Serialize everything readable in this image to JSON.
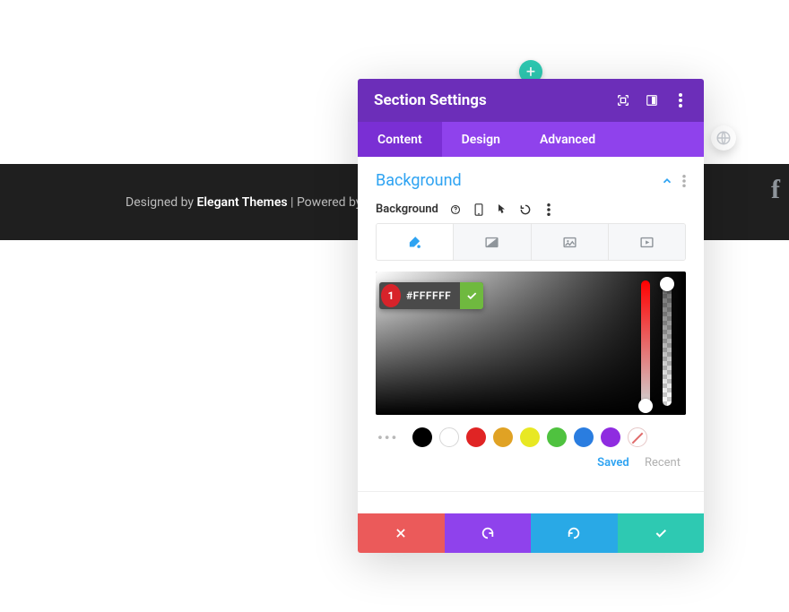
{
  "footer": {
    "designed_by": "Designed by ",
    "brand": "Elegant Themes",
    "powered_by": " | Powered by "
  },
  "add_button_glyph": "+",
  "panel": {
    "title": "Section Settings",
    "tabs": {
      "content": "Content",
      "design": "Design",
      "advanced": "Advanced"
    }
  },
  "bg": {
    "section_title": "Background",
    "label": "Background",
    "hex": "#FFFFFF",
    "marker": "1",
    "saved_label": "Saved",
    "recent_label": "Recent",
    "swatches": [
      "#000000",
      "#ffffff",
      "#e02424",
      "#e0a224",
      "#e8e823",
      "#4fc23f",
      "#2a7de0",
      "#8f2ce0"
    ]
  }
}
